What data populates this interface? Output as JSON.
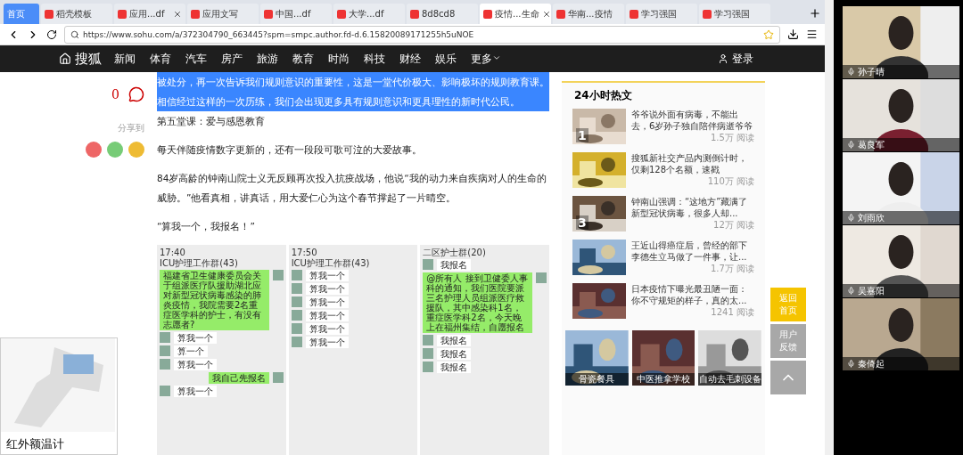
{
  "tabs": [
    {
      "label": "首页",
      "kind": "home",
      "selected": false,
      "closable": false
    },
    {
      "label": "稻壳模板",
      "kind": "page",
      "selected": false,
      "closable": false
    },
    {
      "label": "应用...df",
      "kind": "page",
      "selected": false,
      "closable": true
    },
    {
      "label": "应用文写",
      "kind": "page",
      "selected": false,
      "closable": false
    },
    {
      "label": "中国...df",
      "kind": "page",
      "selected": false,
      "closable": false
    },
    {
      "label": "大学...df",
      "kind": "page",
      "selected": false,
      "closable": false
    },
    {
      "label": "8d8cd8",
      "kind": "page",
      "selected": false,
      "closable": false
    },
    {
      "label": "疫情...生命",
      "kind": "page",
      "selected": true,
      "closable": true
    },
    {
      "label": "华南...疫情",
      "kind": "page",
      "selected": false,
      "closable": false
    },
    {
      "label": "学习强国",
      "kind": "page",
      "selected": false,
      "closable": false
    },
    {
      "label": "学习强国",
      "kind": "page",
      "selected": false,
      "closable": false
    }
  ],
  "address_bar": {
    "url": "https://www.sohu.com/a/372304790_663445?spm=smpc.author.fd-d.6.15820089171255h5uNOE"
  },
  "site_nav": {
    "logo": "搜狐",
    "items": [
      "新闻",
      "体育",
      "汽车",
      "房产",
      "旅游",
      "教育",
      "时尚",
      "科技",
      "财经",
      "娱乐"
    ],
    "more": "更多",
    "login": "登录"
  },
  "article_side": {
    "comment_count": "0",
    "share_label": "分享到"
  },
  "article": {
    "paragraphs": [
      {
        "text": "被处分，再一次告诉我们规则意识的重要性，这是一堂代价极大、影响极坏的规则教育课。",
        "highlighted": true
      },
      {
        "text": "相信经过这样的一次历练，我们会出现更多具有规则意识和更具理性的新时代公民。",
        "highlighted": true
      },
      {
        "text": "第五堂课：爱与感恩教育",
        "highlighted": false
      },
      {
        "text": "每天伴随疫情数字更新的，还有一段段可歌可泣的大爱故事。",
        "highlighted": false
      },
      {
        "text": "84岁高龄的钟南山院士义无反顾再次投入抗疫战场，他说“我的动力来自疾病对人的生命的威胁。”他看真相，讲真话，用大爱仁心为这个春节撑起了一片晴空。",
        "highlighted": false
      },
      {
        "text": "“算我一个，我报名！”",
        "highlighted": false
      }
    ],
    "chat_screens": [
      {
        "time": "17:40",
        "title": "ICU护理工作群(43)",
        "messages": [
          {
            "text": "福建省卫生健康委员会关于组派医疗队援助湖北应对新型冠状病毒感染的肺炎疫情，我院需要2名重症医学科的护士，有没有志愿者?",
            "mine": true
          },
          {
            "text": "算我一个",
            "mine": false
          },
          {
            "text": "算一个",
            "mine": false
          },
          {
            "text": "算我一个",
            "mine": false
          },
          {
            "text": "我自己先报名",
            "mine": true
          },
          {
            "text": "算我一个",
            "mine": false
          }
        ]
      },
      {
        "time": "17:50",
        "title": "ICU护理工作群(43)",
        "messages": [
          {
            "text": "算我一个",
            "mine": false
          },
          {
            "text": "算我一个",
            "mine": false
          },
          {
            "text": "算我一个",
            "mine": false
          },
          {
            "text": "算我一个",
            "mine": false
          },
          {
            "text": "算我一个",
            "mine": false
          },
          {
            "text": "算我一个",
            "mine": false
          }
        ]
      },
      {
        "title": "二区护士群(20)",
        "messages": [
          {
            "text": "我报名",
            "mine": false
          },
          {
            "text": "@所有人 接到卫健委人事科的通知，我们医院要派三名护理人员组派医疗救援队，其中感染科1名，重症医学科2名，今天晚上在福州集结，自愿报名",
            "mine": true
          },
          {
            "text": "我报名",
            "mine": false
          },
          {
            "text": "我报名",
            "mine": false
          },
          {
            "text": "我报名",
            "mine": false
          }
        ]
      }
    ]
  },
  "ad_card": {
    "caption": "红外额温计"
  },
  "hot_list": {
    "title": "24小时热文",
    "items": [
      {
        "rank": "1",
        "title": "爷爷说外面有病毒，不能出去，6岁孙子独自陪伴病逝爷爷",
        "reads": "1.5万 阅读"
      },
      {
        "title": "搜狐新社交产品内测倒计时，仅剩128个名额，速戳",
        "reads": "110万 阅读"
      },
      {
        "rank": "3",
        "title": "钟南山强调：“这地方”藏满了新型冠状病毒，很多人却...",
        "reads": "12万 阅读"
      },
      {
        "title": "王近山得癌症后，曾经的部下李德生立马做了一件事，让...",
        "reads": "1.7万 阅读"
      },
      {
        "title": "日本疫情下曝光最丑陋一面：你不守规矩的样子，真的太...",
        "reads": "1241 阅读"
      }
    ]
  },
  "ads": [
    "骨瓷餐具",
    "中医推拿学校",
    "自动去毛刺设备"
  ],
  "float_buttons": [
    {
      "label": "返回首页",
      "kind": "home"
    },
    {
      "label": "用户反馈",
      "kind": "feedback"
    },
    {
      "kind": "top"
    }
  ],
  "participants": [
    {
      "name": "孙子晴"
    },
    {
      "name": "葛良军"
    },
    {
      "name": "刘雨欣"
    },
    {
      "name": "吴嘉阳"
    },
    {
      "name": "秦倚起"
    }
  ]
}
